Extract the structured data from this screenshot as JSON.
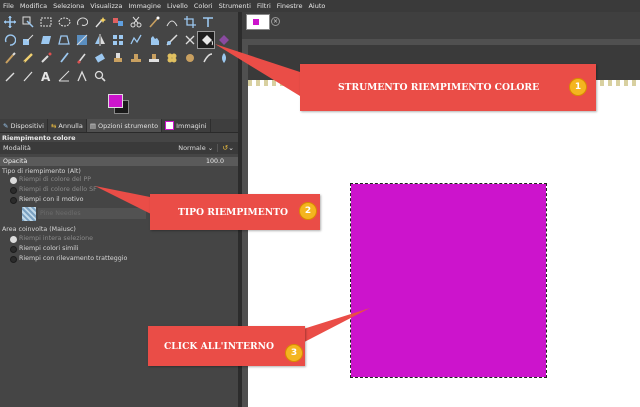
{
  "menu": [
    "File",
    "Modifica",
    "Seleziona",
    "Visualizza",
    "Immagine",
    "Livello",
    "Colori",
    "Strumenti",
    "Filtri",
    "Finestre",
    "Aiuto"
  ],
  "tabs": [
    {
      "label": "Dispositivi",
      "icon": "brush-icon"
    },
    {
      "label": "Annulla",
      "icon": "undo-icon"
    },
    {
      "label": "Opzioni strumento",
      "icon": "options-icon"
    },
    {
      "label": "Immagini",
      "icon": "image-icon"
    }
  ],
  "panel": {
    "title": "Riempimento colore",
    "mode_label": "Modalità",
    "mode_value": "Normale",
    "opacity_label": "Opacità",
    "opacity_value": "100.0",
    "fill_type_heading": "Tipo di riempimento  (Alt)",
    "fill_options": [
      "Riempi di colore del PP",
      "Riempi di colore dello SF",
      "Riempi con il motivo"
    ],
    "pattern_name": "Pine Needles",
    "area_heading": "Area coinvolta  (Maiusc)",
    "area_options": [
      "Riempi intera selezione",
      "Riempi colori simili",
      "Riempi con rilevamento tratteggio"
    ]
  },
  "callouts": [
    {
      "text": "STRUMENTO RIEMPIMENTO COLORE",
      "number": "1"
    },
    {
      "text": "TIPO RIEMPIMENTO",
      "number": "2"
    },
    {
      "text": "CLICK ALL'INTERNO",
      "number": "3"
    }
  ],
  "colors": {
    "foreground": "#cc14cc",
    "background": "#1a1a1a",
    "fill": "#cc14cc",
    "callout": "#ea4d47",
    "badge": "#f4b51f"
  }
}
